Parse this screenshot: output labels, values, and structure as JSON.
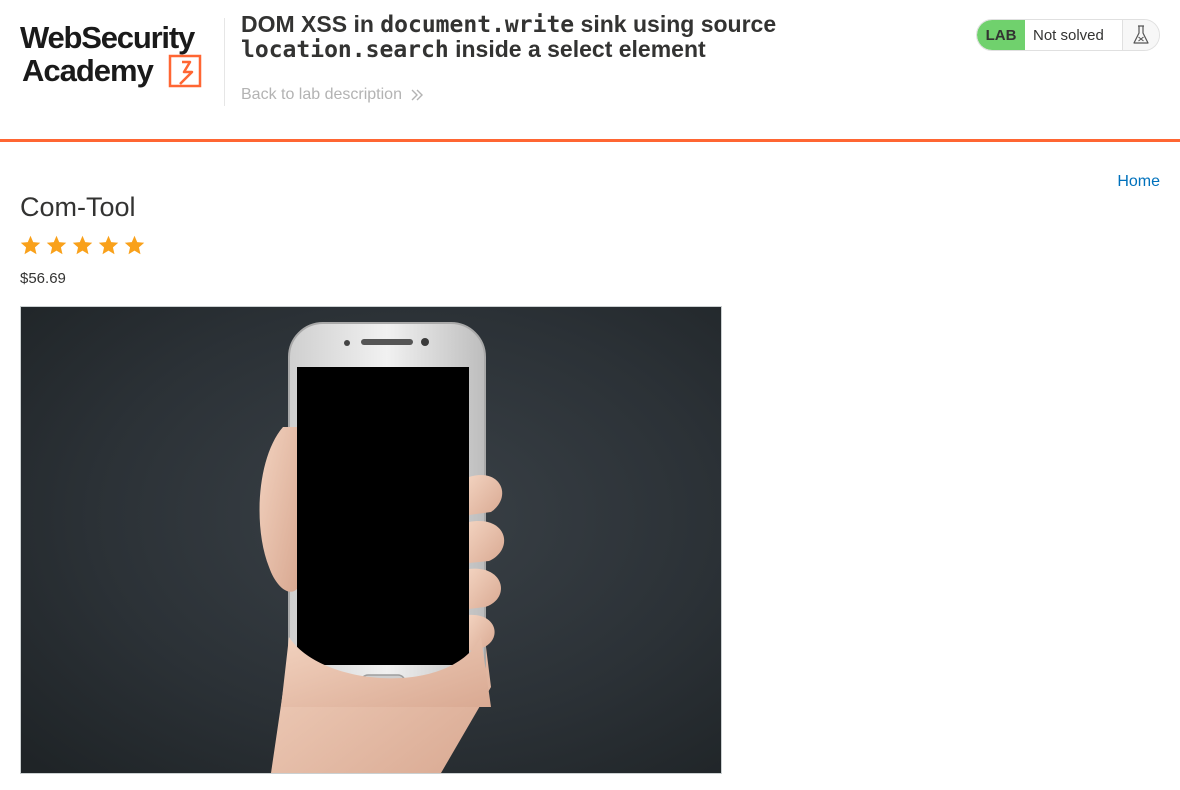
{
  "header": {
    "logo_text": "Web Security Academy",
    "title_parts": {
      "t1": "DOM XSS in ",
      "c1": "document.write",
      "t2": " sink using source",
      "c2": "location.search",
      "t3": " inside a select element"
    },
    "back_link": "Back to lab description",
    "lab_badge": "LAB",
    "lab_status": "Not solved"
  },
  "nav": {
    "home_link": "Home"
  },
  "product": {
    "name": "Com-Tool",
    "rating": 5,
    "rating_max": 5,
    "price": "$56.69"
  },
  "colors": {
    "accent_orange": "#ff6633",
    "lab_green": "#70d16d",
    "link_blue": "#0071bc",
    "star": "#f9a11b"
  },
  "icons": {
    "back": "chevron-double-right-icon",
    "lab": "flask-icon",
    "rating": "star-icon"
  }
}
